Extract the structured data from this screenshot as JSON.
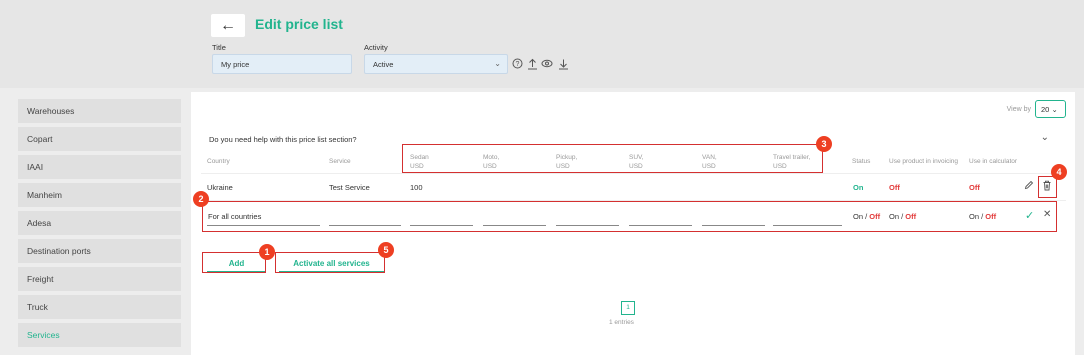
{
  "header": {
    "back_icon": "arrow-left-icon",
    "title": "Edit price list",
    "title_label": "Title",
    "title_value": "My price",
    "activity_label": "Activity",
    "activity_value": "Active",
    "tool_icons": [
      "help-icon",
      "upload-icon",
      "eye-icon",
      "download-icon"
    ]
  },
  "sidebar": {
    "items": [
      {
        "label": "Warehouses"
      },
      {
        "label": "Copart"
      },
      {
        "label": "IAAI"
      },
      {
        "label": "Manheim"
      },
      {
        "label": "Adesa"
      },
      {
        "label": "Destination ports"
      },
      {
        "label": "Freight"
      },
      {
        "label": "Truck"
      },
      {
        "label": "Services",
        "active": true
      }
    ]
  },
  "main": {
    "view_by_label": "View by",
    "view_by_value": "20",
    "help_question": "Do you need help with this price list section?",
    "columns": {
      "country": "Country",
      "service": "Service",
      "sedan": "Sedan",
      "moto": "Moto,",
      "pickup": "Pickup,",
      "suv": "SUV,",
      "van": "VAN,",
      "trailer": "Travel trailer,",
      "currency": "USD",
      "status": "Status",
      "invoicing": "Use product in invoicing",
      "calculator": "Use in calculator"
    },
    "rows": [
      {
        "country": "Ukraine",
        "service": "Test Service",
        "sedan": "100",
        "status": "On",
        "invoicing": "Off",
        "calculator": "Off"
      }
    ],
    "new_row": {
      "country_placeholder": "For all countries",
      "on": "On",
      "sep": "/",
      "off": "Off"
    },
    "add_label": "Add",
    "activate_label": "Activate all services",
    "page": "1",
    "entries": "1 entries"
  },
  "annotations": [
    "1",
    "2",
    "3",
    "4",
    "5"
  ],
  "colors": {
    "accent": "#22b48e",
    "off": "#e23a3a",
    "highlight": "#d43030",
    "badge": "#ee3f22"
  }
}
